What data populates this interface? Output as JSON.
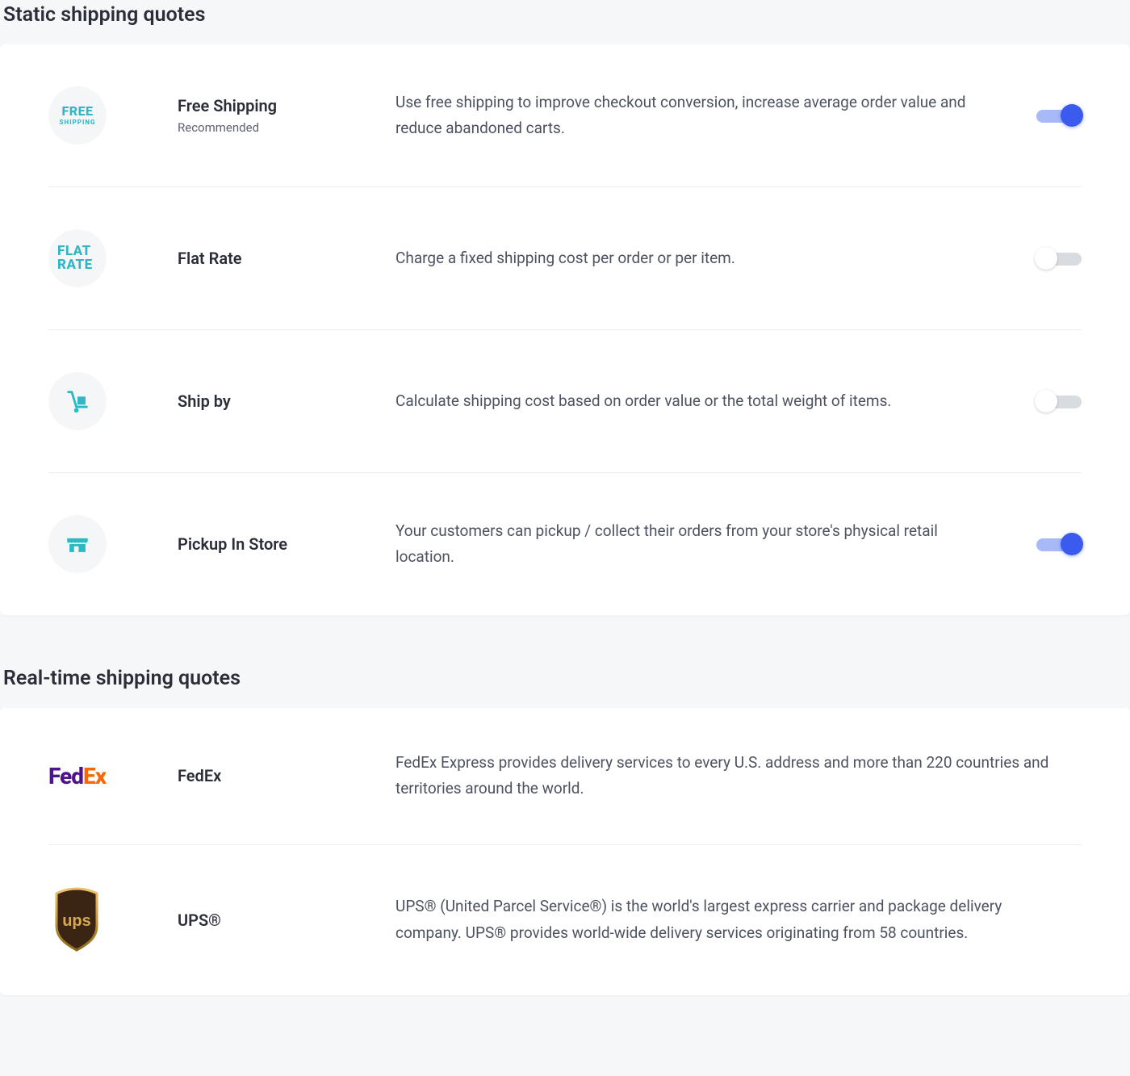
{
  "sections": {
    "static": {
      "title": "Static shipping quotes",
      "rows": [
        {
          "name": "Free Shipping",
          "badge": "Recommended",
          "desc": "Use free shipping to improve checkout conversion, increase average order value and reduce abandoned carts.",
          "enabled": true,
          "icon": {
            "type": "text2",
            "line1": "FREE",
            "line2": "SHIPPING"
          }
        },
        {
          "name": "Flat Rate",
          "badge": "",
          "desc": "Charge a fixed shipping cost per order or per item.",
          "enabled": false,
          "icon": {
            "type": "flat",
            "line1": "FLAT",
            "line2": "RATE"
          }
        },
        {
          "name": "Ship by",
          "badge": "",
          "desc": "Calculate shipping cost based on order value or the total weight of items.",
          "enabled": false,
          "icon": {
            "type": "handtruck"
          }
        },
        {
          "name": "Pickup In Store",
          "badge": "",
          "desc": "Your customers can pickup / collect their orders from your store's physical retail location.",
          "enabled": true,
          "icon": {
            "type": "store"
          }
        }
      ]
    },
    "realtime": {
      "title": "Real-time shipping quotes",
      "rows": [
        {
          "name": "FedEx",
          "desc": "FedEx Express provides delivery services to every U.S. address and more than 220 countries and territories around the world.",
          "carrier": "fedex"
        },
        {
          "name": "UPS®",
          "desc": "UPS® (United Parcel Service®) is the world's largest express carrier and package delivery company. UPS® provides world-wide delivery services originating from 58 countries.",
          "carrier": "ups"
        }
      ]
    }
  }
}
